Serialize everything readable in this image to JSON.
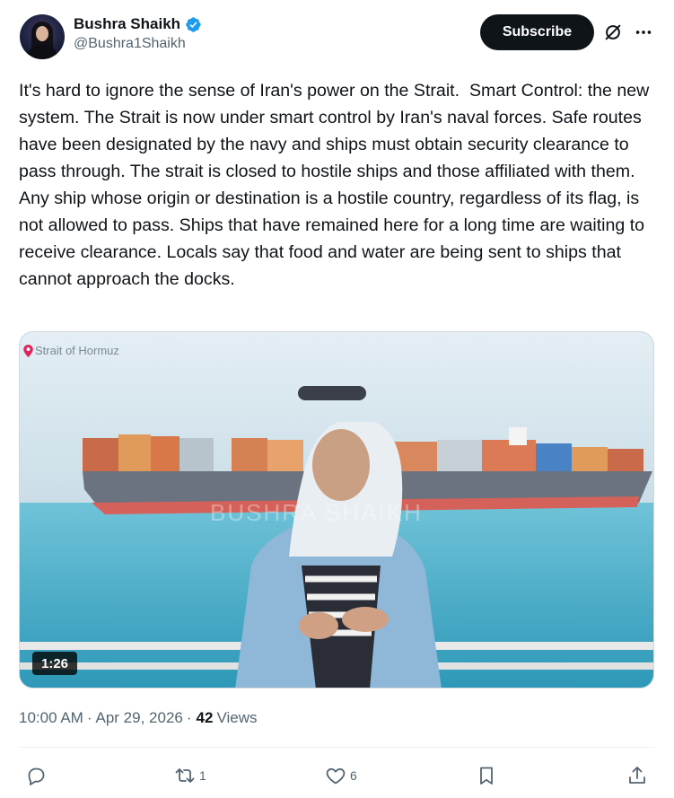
{
  "author": {
    "display_name": "Bushra Shaikh",
    "handle": "@Bushra1Shaikh",
    "verified": true
  },
  "header": {
    "subscribe_label": "Subscribe"
  },
  "tweet": {
    "text": "It's hard to ignore the sense of Iran's power on the Strait.  Smart Control: the new system. The Strait is now under smart control by Iran's naval forces. Safe routes have been designated by the navy and ships must obtain security clearance to pass through. The strait is closed to hostile ships and those affiliated with them. Any ship whose origin or destination is a hostile country, regardless of its flag, is not allowed to pass. Ships that have remained here for a long time are waiting to receive clearance. Locals say that food and water are being sent to ships that cannot approach the docks."
  },
  "media": {
    "location_tag": "Strait of Hormuz",
    "watermark": "BUSHRA SHAIKH",
    "duration": "1:26"
  },
  "meta": {
    "time": "10:00 AM",
    "separator_1": "·",
    "date": "Apr 29, 2026",
    "separator_2": "·",
    "views_count": "42",
    "views_label": "Views"
  },
  "actions": {
    "reply_count": "",
    "repost_count": "1",
    "like_count": "6"
  },
  "colors": {
    "text_primary": "#0f1419",
    "text_secondary": "#536471",
    "verified_blue": "#1d9bf0",
    "subscribe_bg": "#0f1419"
  }
}
